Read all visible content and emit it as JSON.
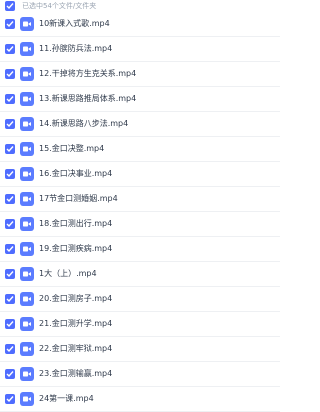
{
  "header": {
    "selected_text": "已选中54个文件/文件夹"
  },
  "files": [
    {
      "name": "10新课入式歌.mp4"
    },
    {
      "name": "11.孙膑防兵法.mp4"
    },
    {
      "name": "12.干掉将方生克关系.mp4"
    },
    {
      "name": "13.新课思路推局体系.mp4"
    },
    {
      "name": "14.新课思路八步法.mp4"
    },
    {
      "name": "15.金口决整.mp4"
    },
    {
      "name": "16.金口决事业.mp4"
    },
    {
      "name": "17节金口测婚姻.mp4"
    },
    {
      "name": "18.金口测出行.mp4"
    },
    {
      "name": "19.金口测疾病.mp4"
    },
    {
      "name": "1大（上）.mp4"
    },
    {
      "name": "20.金口测房子.mp4"
    },
    {
      "name": "21.金口测升学.mp4"
    },
    {
      "name": "22.金口测牢狱.mp4"
    },
    {
      "name": "23.金口测输赢.mp4"
    },
    {
      "name": "24第一课.mp4"
    }
  ],
  "colors": {
    "checkbox": "#4f6cff",
    "video_icon": "#5b7cff"
  }
}
